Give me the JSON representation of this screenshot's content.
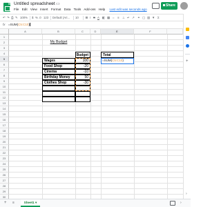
{
  "app": {
    "title": "Untitled spreadsheet",
    "icons": [
      "sheets-logo",
      "star-icon",
      "folder-icon",
      "comment-icon",
      "lock-icon",
      "avatar"
    ],
    "menu": [
      "File",
      "Edit",
      "View",
      "Insert",
      "Format",
      "Data",
      "Tools",
      "Add-ons",
      "Help"
    ],
    "last_edit": "Last edit was seconds ago",
    "share_label": "Share",
    "accent": "#0f9d58"
  },
  "toolbar": {
    "zoom": "100%",
    "currency": "$",
    "percent": "%",
    "decimals": ".0",
    "more_formats": "123",
    "font": "Default (Ari...",
    "font_size": "10",
    "bold": "B",
    "italic": "I",
    "strike": "S",
    "text_color": "A",
    "collapse": "^"
  },
  "formula_bar": {
    "fx": "fx",
    "prefix": "=SUM(",
    "ref": "C5:C10",
    "suffix": ")"
  },
  "columns": [
    "A",
    "B",
    "C",
    "D",
    "E",
    "F"
  ],
  "rows": [
    "1",
    "2",
    "3",
    "4",
    "5",
    "6",
    "7",
    "8",
    "9",
    "10",
    "11",
    "12",
    "13",
    "14",
    "15",
    "16",
    "17",
    "18",
    "19",
    "20",
    "21",
    "22",
    "23",
    "24",
    "25",
    "26",
    "27",
    "28",
    "29",
    "30",
    "31",
    "32"
  ],
  "sheet": {
    "title": "My Budget",
    "header_budget": "Budget",
    "items": [
      {
        "label": "Wages",
        "value": "100"
      },
      {
        "label": "Food Shop",
        "value": "-20"
      },
      {
        "label": "Cinema",
        "value": "-10"
      },
      {
        "label": "Birthday Money",
        "value": "50"
      },
      {
        "label": "Clothes Shop",
        "value": "-30"
      }
    ],
    "total_label": "Total",
    "total_edit": {
      "prefix": "=SUM(",
      "ref": "C5:C10",
      "suffix": ")"
    },
    "active_cell": "E5"
  },
  "bottom": {
    "add_sheet": "+",
    "all_sheets": "≡",
    "sheet_tab": "Sheet1 ▾",
    "arrow": "›"
  },
  "side_panel": {
    "icons": [
      "calendar-icon",
      "keep-icon",
      "tasks-icon"
    ],
    "plus": "+",
    "arrow": "›"
  }
}
